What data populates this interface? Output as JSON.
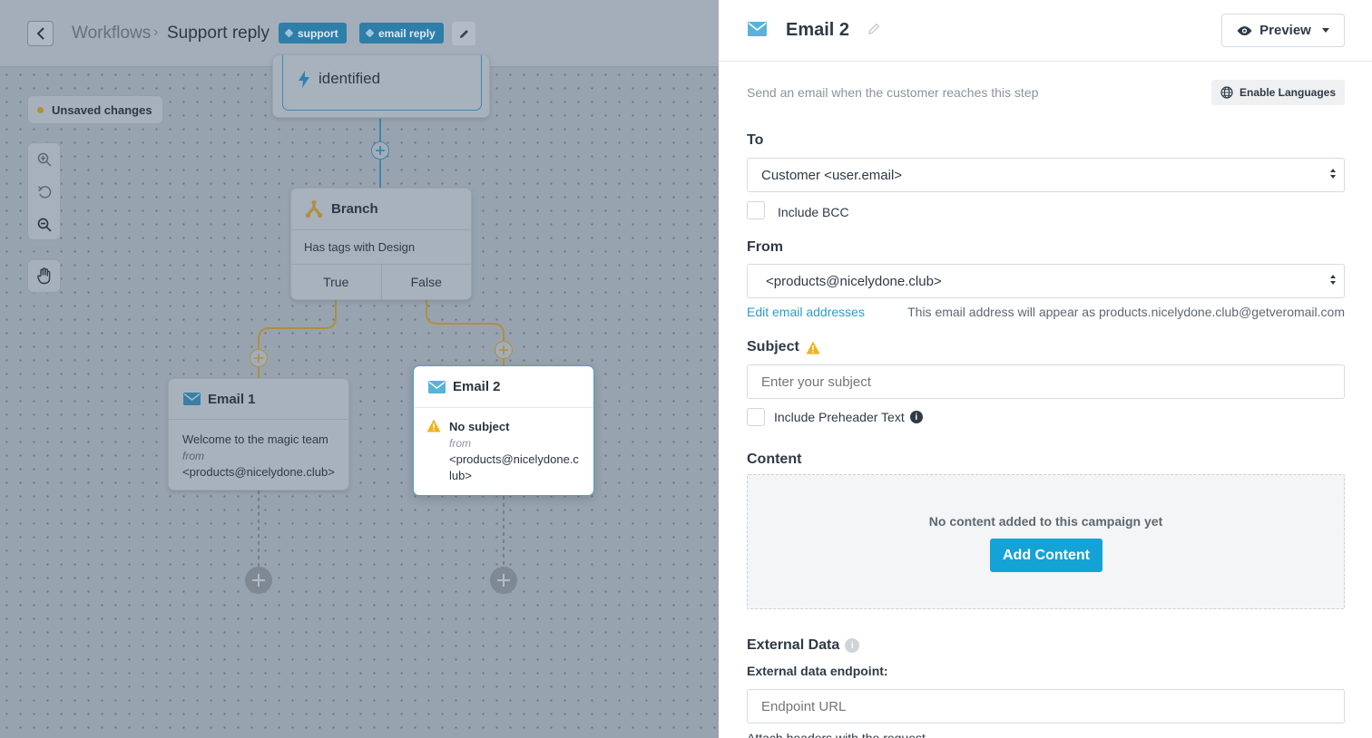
{
  "breadcrumb": {
    "root": "Workflows",
    "separator": "›",
    "title": "Support reply"
  },
  "tags": [
    "support",
    "email reply"
  ],
  "canvas": {
    "unsaved": "Unsaved changes",
    "trigger_label": "identified",
    "branch": {
      "title": "Branch",
      "condition": "Has tags with Design",
      "true_label": "True",
      "false_label": "False"
    },
    "email1": {
      "title": "Email 1",
      "subject": "Welcome to the magic team",
      "from_label": "from",
      "from": "<products@nicelydone.club>"
    },
    "email2": {
      "title": "Email 2",
      "warning": "No subject",
      "from_label": "from",
      "from_line1": "<products@nicelydone.c",
      "from_line2": "lub>"
    }
  },
  "panel": {
    "title": "Email 2",
    "preview_label": "Preview",
    "description": "Send an email when the customer reaches this step",
    "languages_label": "Enable Languages",
    "to": {
      "label": "To",
      "value": "Customer <user.email>",
      "bcc_label": "Include BCC"
    },
    "from": {
      "label": "From",
      "value": "<products@nicelydone.club>",
      "edit_link": "Edit email addresses",
      "hint": "This email address will appear as products.nicelydone.club@getveromail.com"
    },
    "subject": {
      "label": "Subject",
      "placeholder": "Enter your subject",
      "preheader_label": "Include Preheader Text"
    },
    "content": {
      "label": "Content",
      "empty": "No content added to this campaign yet",
      "add_label": "Add Content"
    },
    "external": {
      "label": "External Data",
      "endpoint_label": "External data endpoint:",
      "endpoint_placeholder": "Endpoint URL",
      "next_label": "Attach headers with the request"
    }
  },
  "colors": {
    "accent": "#13a3d7",
    "link": "#2b9cc8",
    "warning": "#f2b21a",
    "tag": "#2d7ea8",
    "canvas_overlay": "#98a3b0"
  }
}
